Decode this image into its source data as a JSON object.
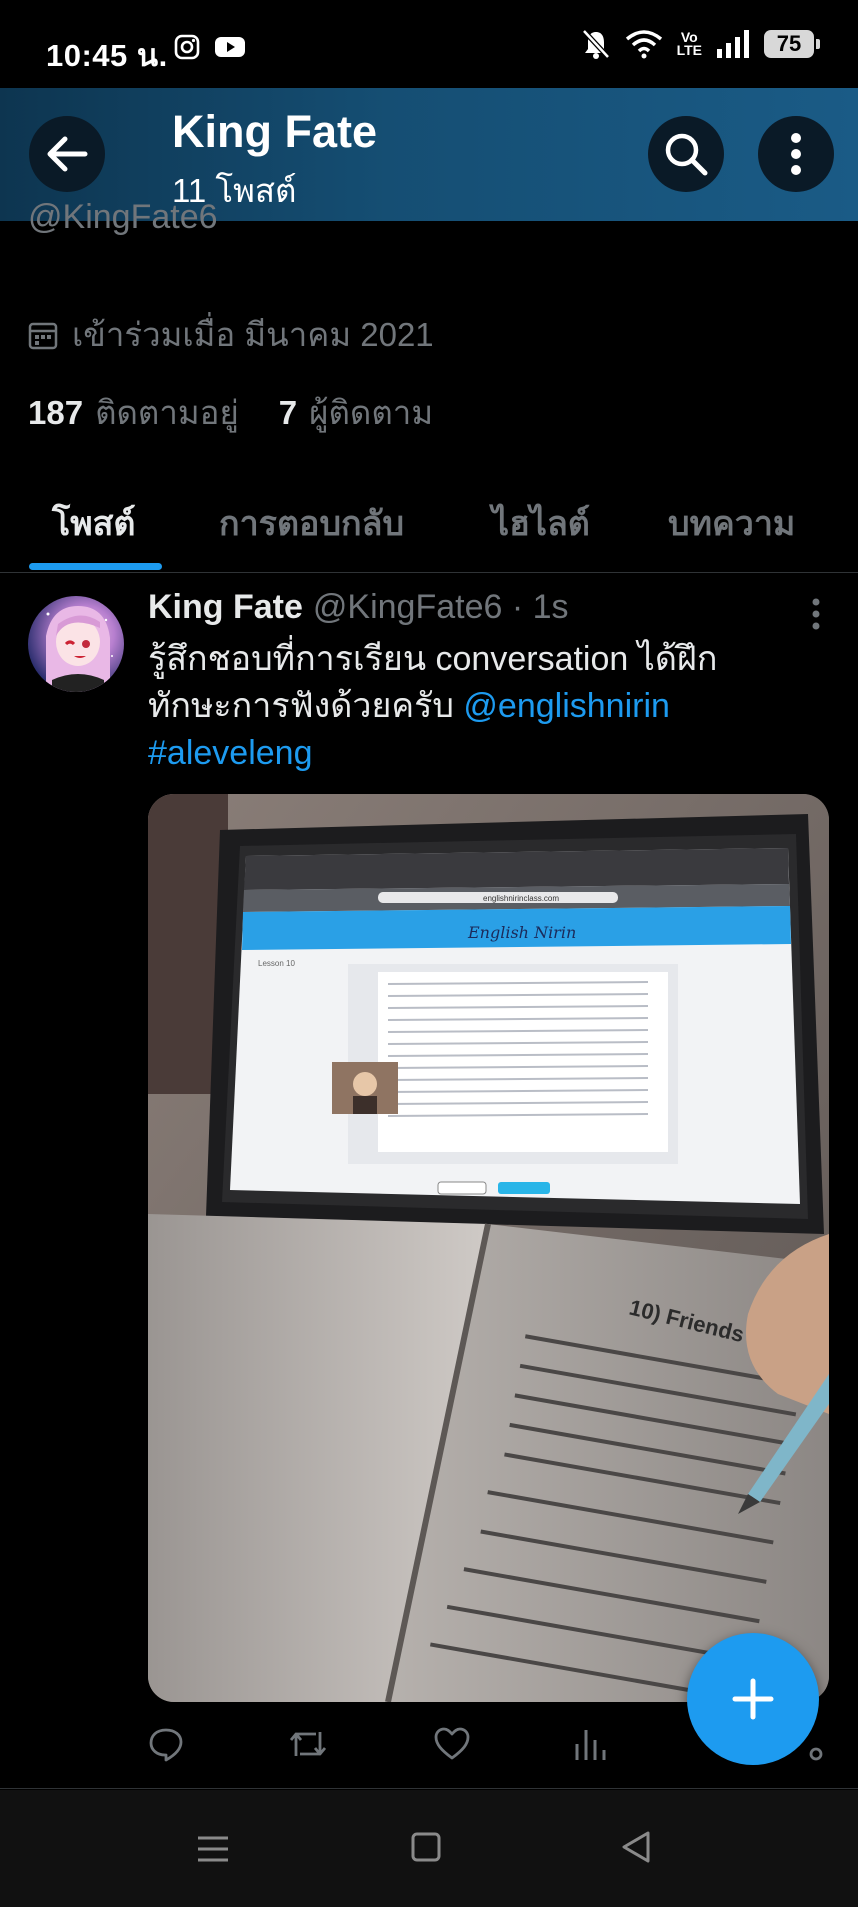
{
  "status_bar": {
    "time": "10:45 น.",
    "volte_line1": "Vo",
    "volte_line2": "LTE",
    "battery": "75"
  },
  "header": {
    "title": "King Fate",
    "subtitle": "11 โพสต์"
  },
  "profile": {
    "handle_partial": "@KingFate6",
    "joined": "เข้าร่วมเมื่อ มีนาคม 2021",
    "following_count": "187",
    "following_label": "ติดตามอยู่",
    "followers_count": "7",
    "followers_label": "ผู้ติดตาม"
  },
  "tabs": [
    {
      "label": "โพสต์",
      "active": true
    },
    {
      "label": "การตอบกลับ",
      "active": false
    },
    {
      "label": "ไฮไลต์",
      "active": false
    },
    {
      "label": "บทความ",
      "active": false
    }
  ],
  "tweet": {
    "name": "King Fate",
    "meta": "@KingFate6 · 1s",
    "text_line1": "รู้สึกชอบที่การเรียน conversation ได้ฝึก",
    "text_line2": "ทักษะการฟังด้วยครับ",
    "mention": "@englishnirin",
    "hashtag": "#aleveleng"
  },
  "media": {
    "site_brand": "English Nirin",
    "url": "englishnirinclass.com",
    "lesson": "Lesson 10",
    "book_heading": "10) Friends"
  },
  "colors": {
    "accent": "#1d9bf0",
    "background": "#000000",
    "header_start": "#0d3550",
    "header_end": "#1a5b86"
  }
}
